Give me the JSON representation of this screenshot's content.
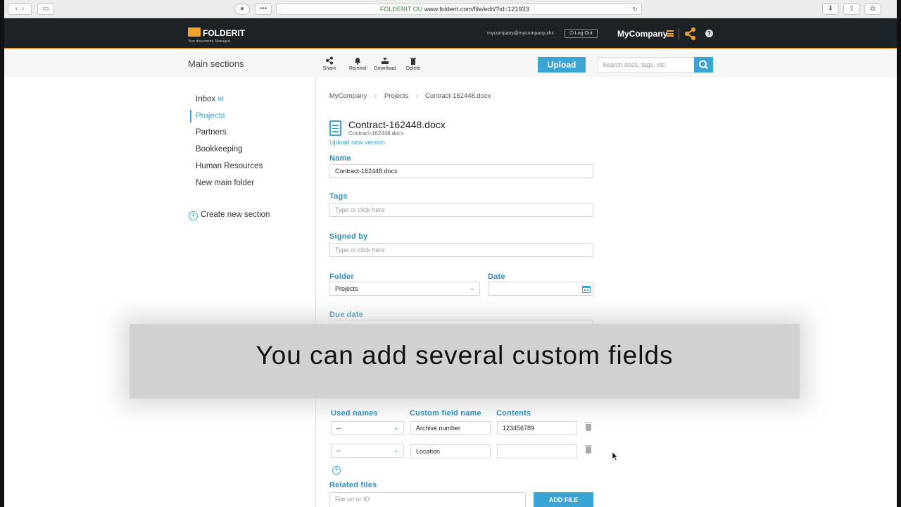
{
  "browser": {
    "secure_label": "FOLDERIT OU",
    "url": "www.folderit.com/file/edit/?id=121933"
  },
  "header": {
    "logo_name": "FOLDERIT",
    "logo_tagline": "Your documents. Managed.",
    "email": "mycompany@mycompany.xhx",
    "logout_label": "Log Out",
    "company": "MyCompany",
    "help_label": "?"
  },
  "toolbar": {
    "section_title": "Main sections",
    "share_label": "Share",
    "remind_label": "Remind",
    "download_label": "Download",
    "delete_label": "Delete",
    "upload_label": "Upload",
    "search_placeholder": "Search docs, tags, etc"
  },
  "sidebar": {
    "items": [
      {
        "label": "Inbox"
      },
      {
        "label": "Projects"
      },
      {
        "label": "Partners"
      },
      {
        "label": "Bookkeeping"
      },
      {
        "label": "Human Resources"
      },
      {
        "label": "New main folder"
      }
    ],
    "create_label": "Create new section"
  },
  "breadcrumb": [
    "MyCompany",
    "Projects",
    "Contract-162448.docx"
  ],
  "file": {
    "title": "Contract-162448.docx",
    "subtitle": "Contract-162448.docx",
    "upload_new_version": "Upload new version"
  },
  "form": {
    "name_label": "Name",
    "name_value": "Contract-162448.docx",
    "tags_label": "Tags",
    "tags_placeholder": "Type or click here",
    "signed_label": "Signed by",
    "signed_placeholder": "Type or click here",
    "folder_label": "Folder",
    "folder_value": "Projects",
    "date_label": "Date",
    "due_label": "Due date"
  },
  "custom_fields": {
    "col_used": "Used names",
    "col_name": "Custom field name",
    "col_contents": "Contents",
    "rows": [
      {
        "used": "--",
        "name": "Archive number",
        "contents": "123456789"
      },
      {
        "used": "--",
        "name": "Location",
        "contents": ""
      }
    ]
  },
  "related": {
    "label": "Related files",
    "placeholder": "File url or ID",
    "add_label": "ADD FILE"
  },
  "overlay": {
    "caption": "You can add several custom fields"
  },
  "colors": {
    "accent": "#3aa4d4",
    "brand_orange": "#f0a52a",
    "header_bg": "#1d2226"
  }
}
